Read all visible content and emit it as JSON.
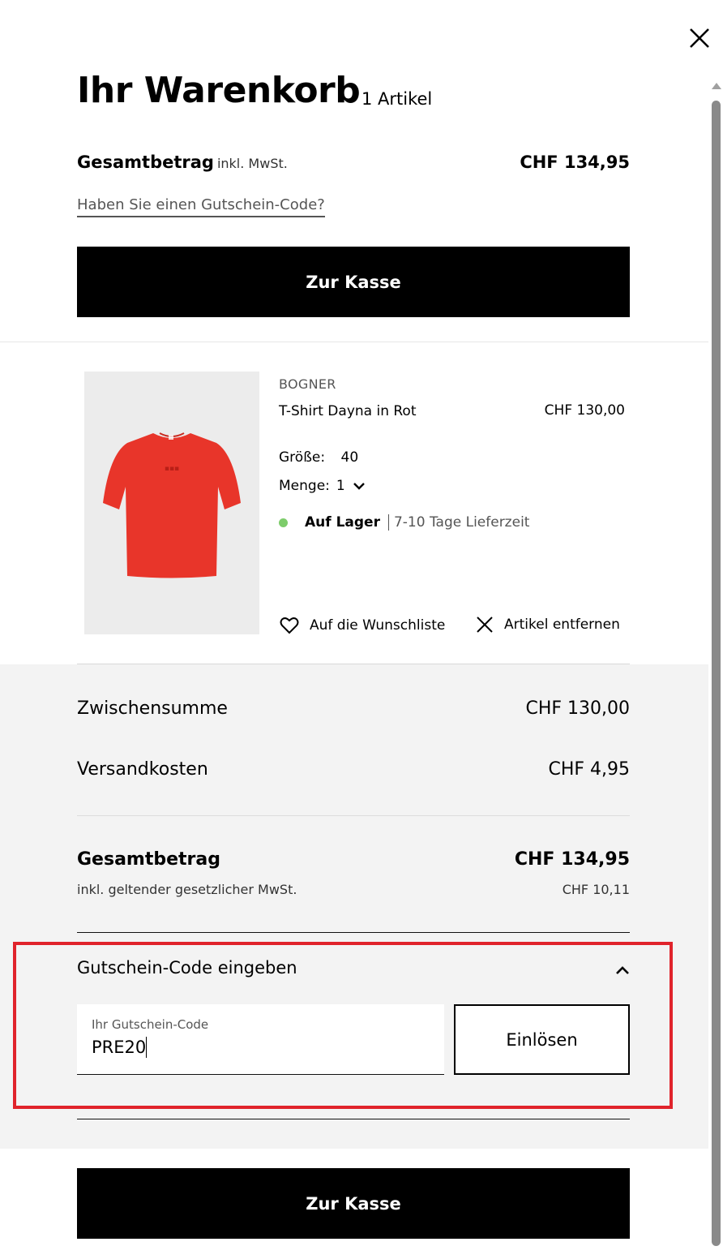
{
  "header": {
    "title": "Ihr Warenkorb",
    "item_count": "1 Artikel"
  },
  "top_summary": {
    "total_label": "Gesamtbetrag",
    "total_suffix": "inkl. MwSt.",
    "total_value": "CHF 134,95",
    "voucher_link": "Haben Sie einen Gutschein-Code?",
    "checkout_label": "Zur Kasse"
  },
  "product": {
    "brand": "BOGNER",
    "name": "T-Shirt Dayna in Rot",
    "price": "CHF 130,00",
    "size_label": "Größe:",
    "size_value": "40",
    "qty_label": "Menge:",
    "qty_value": "1",
    "stock_status": "Auf Lager",
    "delivery_time": "7-10 Tage Lieferzeit",
    "wishlist_label": "Auf die Wunschliste",
    "remove_label": "Artikel entfernen",
    "shirt_color": "#e8352a",
    "stock_color": "#7dcc6b"
  },
  "summary": {
    "subtotal_label": "Zwischensumme",
    "subtotal_value": "CHF 130,00",
    "shipping_label": "Versandkosten",
    "shipping_value": "CHF 4,95",
    "grand_label": "Gesamtbetrag",
    "grand_value": "CHF 134,95",
    "vat_label": "inkl. geltender gesetzlicher MwSt.",
    "vat_value": "CHF 10,11"
  },
  "coupon": {
    "title": "Gutschein-Code eingeben",
    "input_label": "Ihr Gutschein-Code",
    "input_value": "PRE20",
    "redeem_label": "Einlösen",
    "highlight_color": "#e0232b"
  },
  "footer": {
    "checkout_label": "Zur Kasse"
  }
}
